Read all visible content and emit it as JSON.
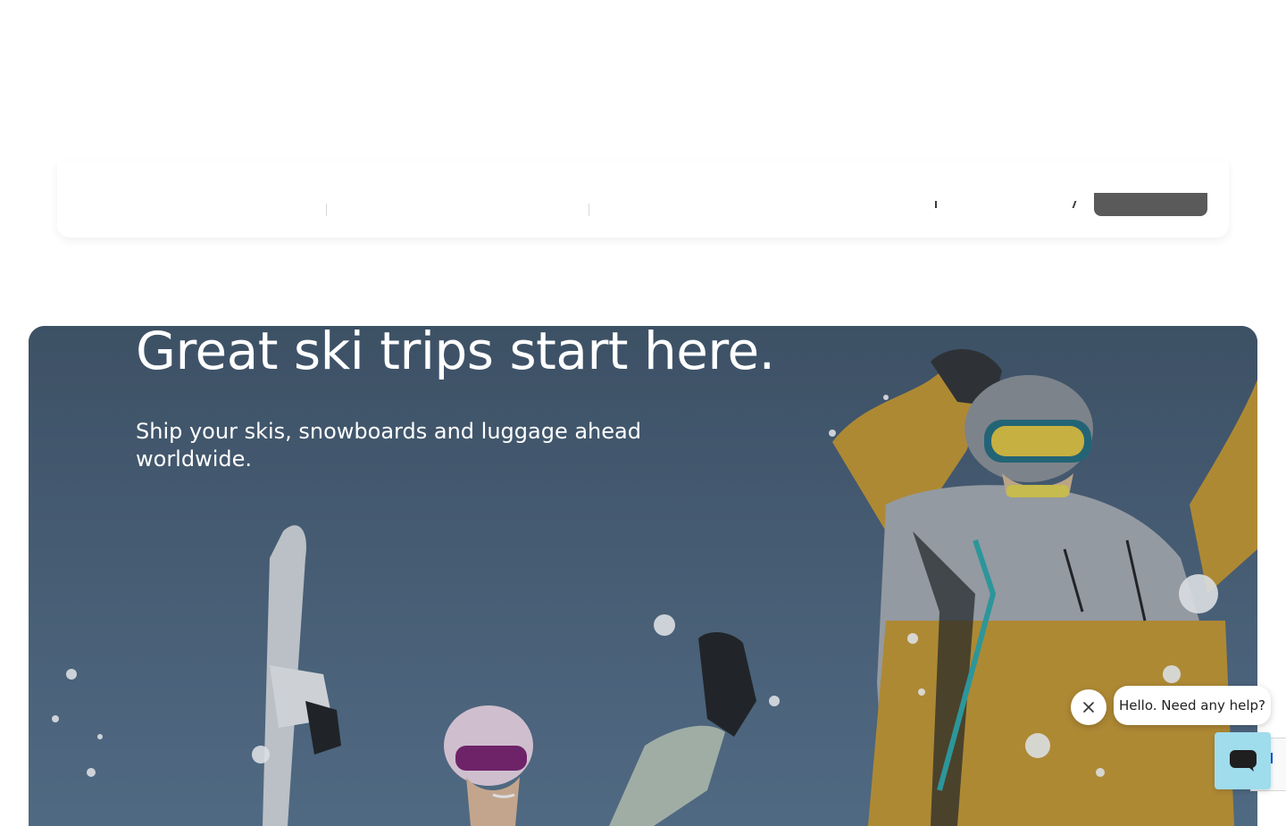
{
  "hero": {
    "title": "Great ski trips start here.",
    "subtitle": "Ship your skis, snowboards and luggage ahead worldwide."
  },
  "chat": {
    "greeting": "Hello. Need any help?",
    "close_icon": "close-icon",
    "launcher_icon": "chat-icon"
  },
  "colors": {
    "hero_overlay": "#4b6178",
    "chat_launcher": "#9fdcec",
    "search_button": "#5a5a5a"
  }
}
